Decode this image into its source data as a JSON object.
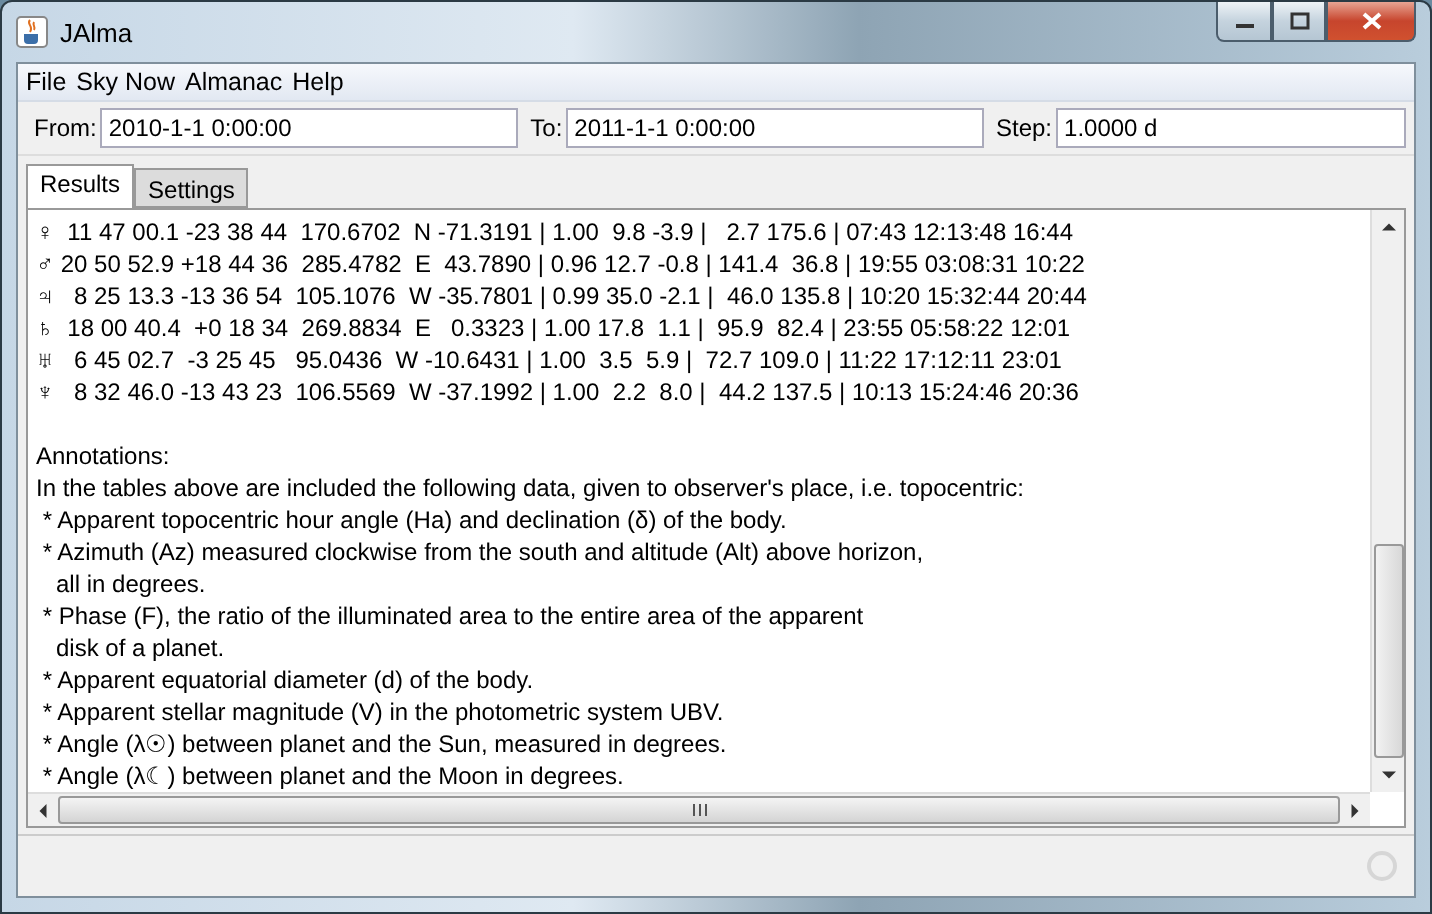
{
  "window": {
    "title": "JAlma"
  },
  "menu": [
    "File",
    "Sky Now",
    "Almanac",
    "Help"
  ],
  "toolbar": [
    {
      "label": "From:",
      "value": "2010-1-1 0:00:00"
    },
    {
      "label": "To:",
      "value": "2011-1-1 0:00:00"
    },
    {
      "label": "Step:",
      "value": "1.0000 d"
    }
  ],
  "tabs": [
    {
      "label": "Results",
      "selected": true
    },
    {
      "label": "Settings",
      "selected": false
    }
  ],
  "results": {
    "rows": [
      "♀  11 47 00.1 -23 38 44  170.6702  N -71.3191 | 1.00  9.8 -3.9 |   2.7 175.6 | 07:43 12:13:48 16:44",
      "♂ 20 50 52.9 +18 44 36  285.4782  E  43.7890 | 0.96 12.7 -0.8 | 141.4  36.8 | 19:55 03:08:31 10:22",
      "♃   8 25 13.3 -13 36 54  105.1076  W -35.7801 | 0.99 35.0 -2.1 |  46.0 135.8 | 10:20 15:32:44 20:44",
      "♄  18 00 40.4  +0 18 34  269.8834  E   0.3323 | 1.00 17.8  1.1 |  95.9  82.4 | 23:55 05:58:22 12:01",
      "♅   6 45 02.7  -3 25 45   95.0436  W -10.6431 | 1.00  3.5  5.9 |  72.7 109.0 | 11:22 17:12:11 23:01",
      "♆   8 32 46.0 -13 43 23  106.5569  W -37.1992 | 1.00  2.2  8.0 |  44.2 137.5 | 10:13 15:24:46 20:36"
    ],
    "notes": [
      "Annotations:",
      "In the tables above are included the following data, given to observer's place, i.e. topocentric:",
      " * Apparent topocentric hour angle (Ha) and declination (δ) of the body.",
      " * Azimuth (Az) measured clockwise from the south and altitude (Alt) above horizon,",
      "   all in degrees.",
      " * Phase (F), the ratio of the illuminated area to the entire area of the apparent",
      "   disk of a planet.",
      " * Apparent equatorial diameter (d) of the body.",
      " * Apparent stellar magnitude (V) in the photometric system UBV.",
      " * Angle (λ☉) between planet and the Sun, measured in degrees.",
      " * Angle (λ☾) between planet and the Moon in degrees."
    ]
  }
}
